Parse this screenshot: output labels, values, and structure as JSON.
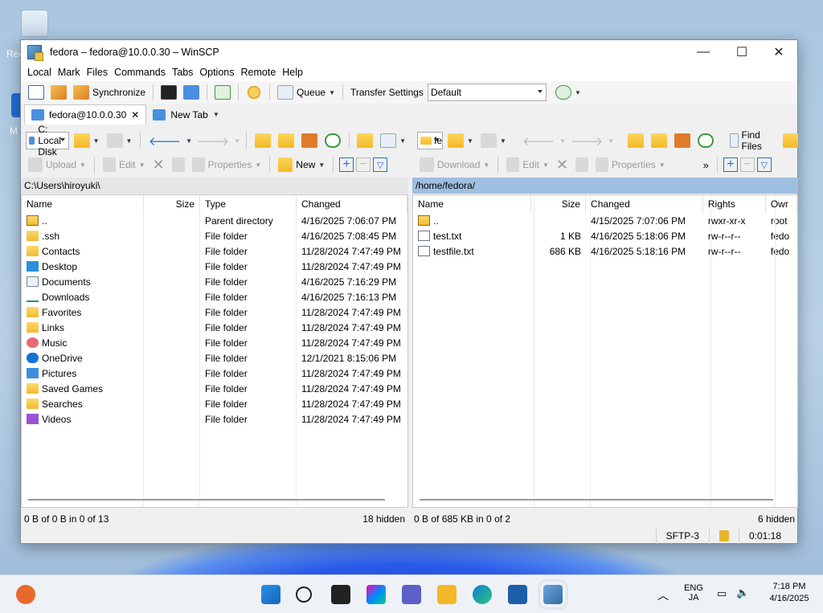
{
  "window": {
    "title": "fedora – fedora@10.0.0.30 – WinSCP",
    "min": "—",
    "max": "☐",
    "close": "✕"
  },
  "desktop": {
    "label1": "Rec",
    "label2": "M"
  },
  "menu": [
    "Local",
    "Mark",
    "Files",
    "Commands",
    "Tabs",
    "Options",
    "Remote",
    "Help"
  ],
  "toolbar": {
    "synchronize": "Synchronize",
    "queue": "Queue",
    "transfer_settings_label": "Transfer Settings",
    "transfer_settings_value": "Default"
  },
  "tabs": [
    {
      "label": "fedora@10.0.0.30",
      "close": "✕"
    },
    {
      "label": "New Tab"
    }
  ],
  "local": {
    "drive": "C: Local Disk",
    "upload": "Upload",
    "edit": "Edit",
    "properties": "Properties",
    "new": "New",
    "path": "C:\\Users\\hiroyuki\\",
    "columns": [
      "Name",
      "Size",
      "Type",
      "Changed"
    ],
    "rows": [
      {
        "icon": "parent-folder-icon",
        "name": "..",
        "size": "",
        "type": "Parent directory",
        "changed": "4/16/2025 7:06:07 PM"
      },
      {
        "icon": "folder-icon",
        "name": ".ssh",
        "size": "",
        "type": "File folder",
        "changed": "4/16/2025 7:08:45 PM"
      },
      {
        "icon": "contacts-folder-icon",
        "name": "Contacts",
        "size": "",
        "type": "File folder",
        "changed": "11/28/2024 7:47:49 PM"
      },
      {
        "icon": "desktop-folder-icon",
        "name": "Desktop",
        "size": "",
        "type": "File folder",
        "changed": "11/28/2024 7:47:49 PM"
      },
      {
        "icon": "documents-folder-icon",
        "name": "Documents",
        "size": "",
        "type": "File folder",
        "changed": "4/16/2025 7:16:29 PM"
      },
      {
        "icon": "downloads-folder-icon",
        "name": "Downloads",
        "size": "",
        "type": "File folder",
        "changed": "4/16/2025 7:16:13 PM"
      },
      {
        "icon": "favorites-folder-icon",
        "name": "Favorites",
        "size": "",
        "type": "File folder",
        "changed": "11/28/2024 7:47:49 PM"
      },
      {
        "icon": "links-folder-icon",
        "name": "Links",
        "size": "",
        "type": "File folder",
        "changed": "11/28/2024 7:47:49 PM"
      },
      {
        "icon": "music-folder-icon",
        "name": "Music",
        "size": "",
        "type": "File folder",
        "changed": "11/28/2024 7:47:49 PM"
      },
      {
        "icon": "onedrive-folder-icon",
        "name": "OneDrive",
        "size": "",
        "type": "File folder",
        "changed": "12/1/2021 8:15:06 PM"
      },
      {
        "icon": "pictures-folder-icon",
        "name": "Pictures",
        "size": "",
        "type": "File folder",
        "changed": "11/28/2024 7:47:49 PM"
      },
      {
        "icon": "saved-games-folder-icon",
        "name": "Saved Games",
        "size": "",
        "type": "File folder",
        "changed": "11/28/2024 7:47:49 PM"
      },
      {
        "icon": "searches-folder-icon",
        "name": "Searches",
        "size": "",
        "type": "File folder",
        "changed": "11/28/2024 7:47:49 PM"
      },
      {
        "icon": "videos-folder-icon",
        "name": "Videos",
        "size": "",
        "type": "File folder",
        "changed": "11/28/2024 7:47:49 PM"
      }
    ],
    "status": "0 B of 0 B in 0 of 13",
    "hidden": "18 hidden"
  },
  "remote": {
    "dir": "fe",
    "download": "Download",
    "edit": "Edit",
    "properties": "Properties",
    "find_files": "Find Files",
    "path": "/home/fedora/",
    "columns": [
      "Name",
      "Size",
      "Changed",
      "Rights",
      "Owr"
    ],
    "rows": [
      {
        "icon": "parent-folder-icon",
        "name": "..",
        "size": "",
        "changed": "4/15/2025 7:07:06 PM",
        "rights": "rwxr-xr-x",
        "owner": "root"
      },
      {
        "icon": "text-file-icon",
        "name": "test.txt",
        "size": "1 KB",
        "changed": "4/16/2025 5:18:06 PM",
        "rights": "rw-r--r--",
        "owner": "fedo"
      },
      {
        "icon": "text-file-icon",
        "name": "testfile.txt",
        "size": "686 KB",
        "changed": "4/16/2025 5:18:16 PM",
        "rights": "rw-r--r--",
        "owner": "fedo"
      }
    ],
    "status": "0 B of 685 KB in 0 of 2",
    "hidden": "6 hidden"
  },
  "bottom": {
    "protocol": "SFTP-3",
    "elapsed": "0:01:18"
  },
  "taskbar": {
    "lang1": "ENG",
    "lang2": "JA",
    "time": "7:18 PM",
    "date": "4/16/2025"
  }
}
